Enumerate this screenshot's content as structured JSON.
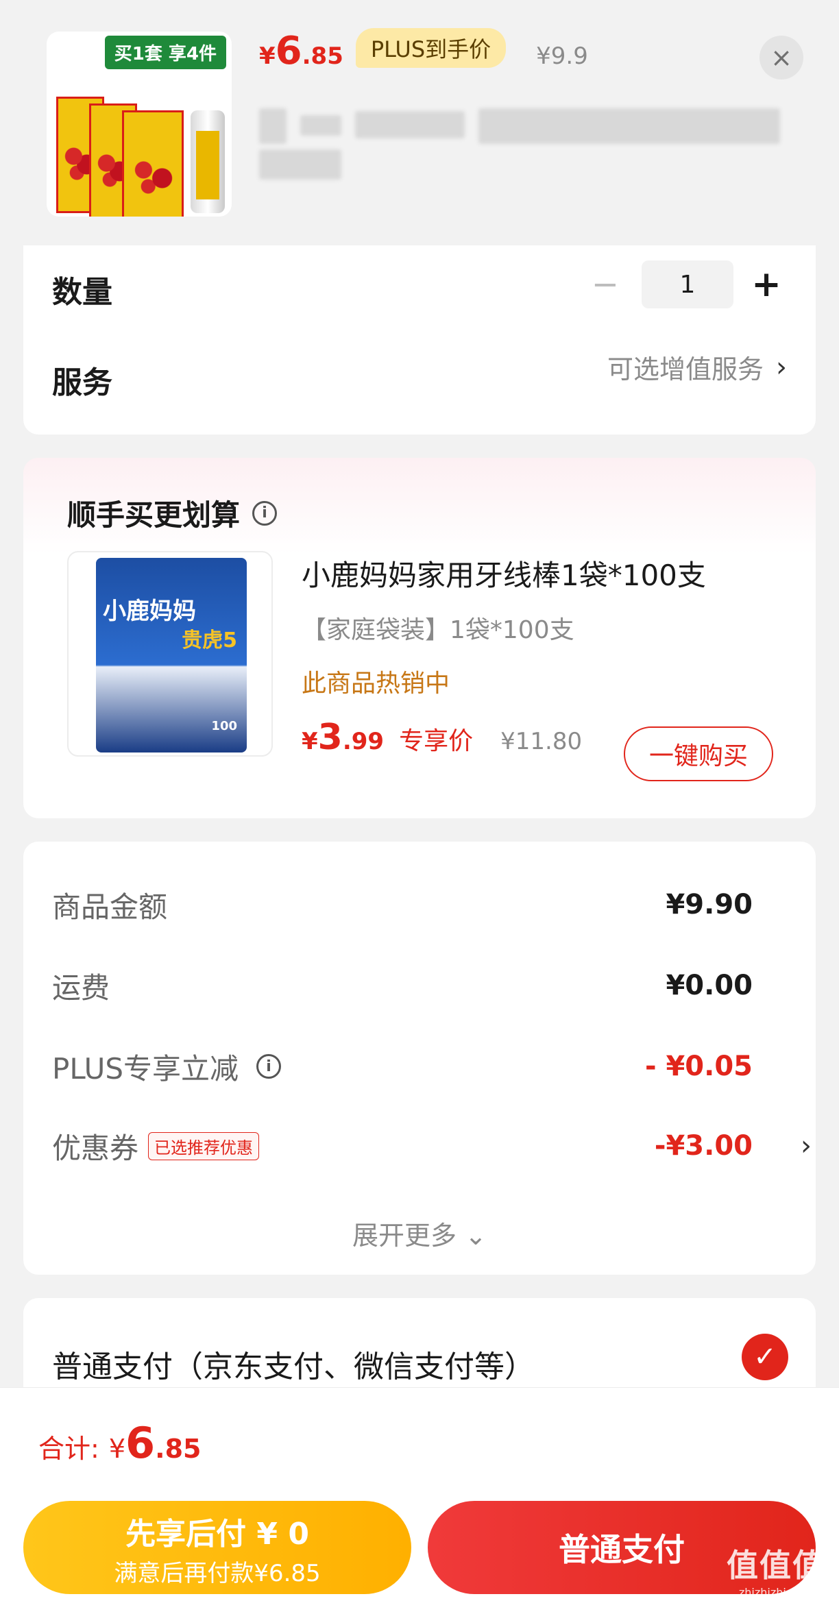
{
  "product": {
    "thumb_banner": "买1套 享4件",
    "price_symbol": "¥",
    "price_int": "6",
    "price_dec": ".85",
    "plus_label": "PLUS到手价",
    "original_price": "¥9.9",
    "close_icon": "×"
  },
  "quantity": {
    "label": "数量",
    "minus": "−",
    "value": "1",
    "plus": "+"
  },
  "service": {
    "label": "服务",
    "value": "可选增值服务",
    "chevron": "›"
  },
  "upsell": {
    "title": "顺手买更划算",
    "info_icon": "i",
    "thumb_brand": "小鹿妈妈",
    "thumb_sub": "贵虎5",
    "thumb_count": "100",
    "name": "小鹿妈妈家用牙线棒1袋*100支",
    "spec": "【家庭袋装】1袋*100支",
    "hot": "此商品热销中",
    "price_symbol": "¥",
    "price_int": "3",
    "price_dec": ".99",
    "price_tag": "专享价",
    "original_price": "¥11.80",
    "buy_label": "一键购买"
  },
  "summary": {
    "rows": [
      {
        "label": "商品金额",
        "value": "¥9.90"
      },
      {
        "label": "运费",
        "value": "¥0.00"
      },
      {
        "label": "PLUS专享立减",
        "value": "- ¥0.05"
      },
      {
        "label": "优惠券",
        "badge": "已选推荐优惠",
        "value": "-¥3.00"
      }
    ],
    "info_icon": "i",
    "chevron": "›",
    "expand": "展开更多 ⌄"
  },
  "payment": {
    "label": "普通支付（京东支付、微信支付等）",
    "check": "✓"
  },
  "total": {
    "label": "合计:",
    "symbol": "¥",
    "int": "6",
    "dec": ".85"
  },
  "actions": {
    "bnpl_main": "先享后付 ¥ 0",
    "bnpl_sub": "满意后再付款¥6.85",
    "pay_label": "普通支付"
  },
  "watermark": {
    "big": "值值值",
    "small": "zhizhizhi.com"
  },
  "colors": {
    "accent": "#e1251b",
    "gold": "#ffb000",
    "hot": "#c77716"
  }
}
